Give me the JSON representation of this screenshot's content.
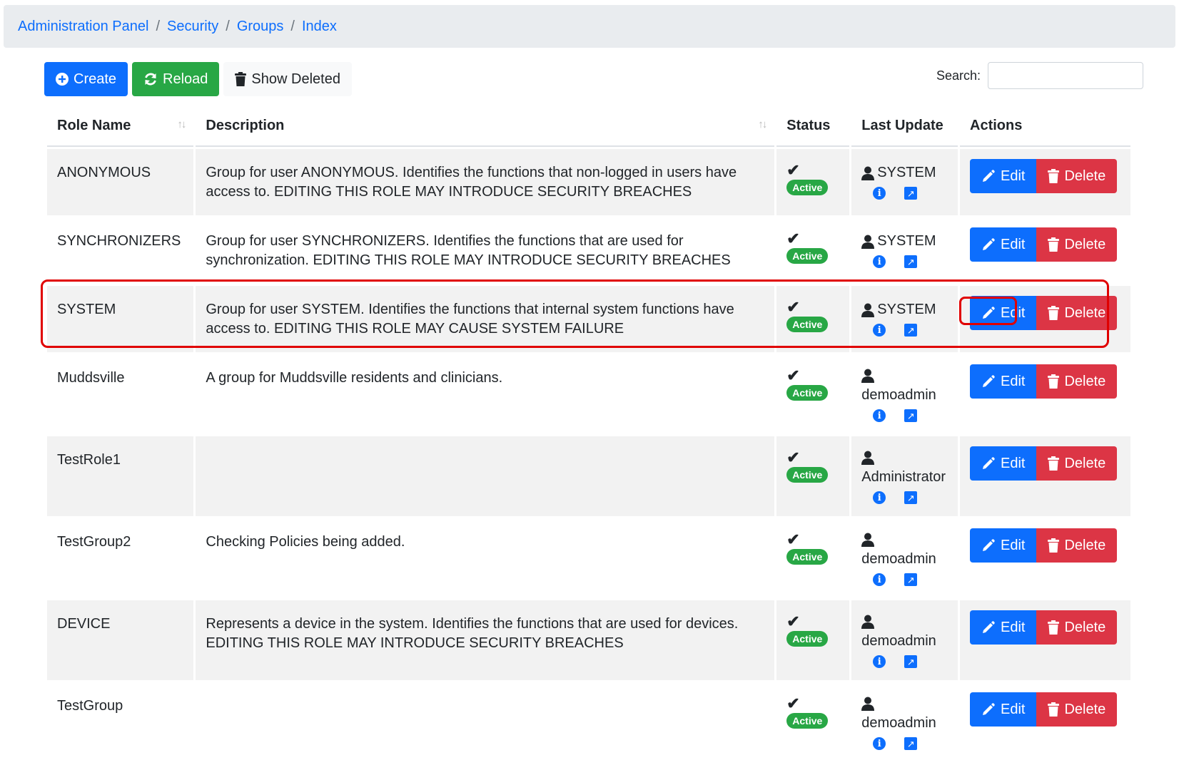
{
  "breadcrumb": [
    "Administration Panel",
    "Security",
    "Groups",
    "Index"
  ],
  "toolbar": {
    "create": "Create",
    "reload": "Reload",
    "show_deleted": "Show Deleted"
  },
  "search": {
    "label": "Search:",
    "value": ""
  },
  "table": {
    "headers": [
      "Role Name",
      "Description",
      "Status",
      "Last Update",
      "Actions"
    ],
    "rows": [
      {
        "name": "ANONYMOUS",
        "description": "Group for user ANONYMOUS. Identifies the functions that non-logged in users have access to. EDITING THIS ROLE MAY INTRODUCE SECURITY BREACHES",
        "status": "Active",
        "updated_by": "SYSTEM"
      },
      {
        "name": "SYNCHRONIZERS",
        "description": "Group for user SYNCHRONIZERS. Identifies the functions that are used for synchronization. EDITING THIS ROLE MAY INTRODUCE SECURITY BREACHES",
        "status": "Active",
        "updated_by": "SYSTEM"
      },
      {
        "name": "SYSTEM",
        "description": "Group for user SYSTEM. Identifies the functions that internal system functions have access to. EDITING THIS ROLE MAY CAUSE SYSTEM FAILURE",
        "status": "Active",
        "updated_by": "SYSTEM"
      },
      {
        "name": "Muddsville",
        "description": "A group for Muddsville residents and clinicians.",
        "status": "Active",
        "updated_by": "demoadmin"
      },
      {
        "name": "TestRole1",
        "description": "",
        "status": "Active",
        "updated_by": "Administrator"
      },
      {
        "name": "TestGroup2",
        "description": "Checking Policies being added.",
        "status": "Active",
        "updated_by": "demoadmin"
      },
      {
        "name": "DEVICE",
        "description": "Represents a device in the system. Identifies the functions that are used for devices. EDITING THIS ROLE MAY INTRODUCE SECURITY BREACHES",
        "status": "Active",
        "updated_by": "demoadmin"
      },
      {
        "name": "TestGroup",
        "description": "",
        "status": "Active",
        "updated_by": "demoadmin"
      }
    ]
  },
  "actions": {
    "edit": "Edit",
    "delete": "Delete"
  },
  "icons": {
    "create": "plus-circle-icon",
    "reload": "sync-icon",
    "show_deleted": "trash-icon",
    "sort": "sort-icon",
    "status": "check-icon",
    "user": "user-icon",
    "info": "info-icon",
    "open": "external-link-icon",
    "edit": "pencil-icon",
    "delete": "trash-icon"
  },
  "colors": {
    "primary": "#0d6efd",
    "success": "#28a745",
    "danger": "#dc3545",
    "highlight": "#e00000"
  }
}
